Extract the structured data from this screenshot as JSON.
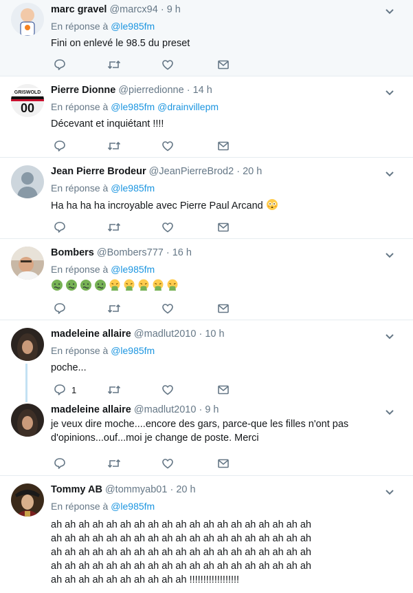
{
  "reply_prefix": "En réponse à",
  "tweets": [
    {
      "name": "marc gravel",
      "handle": "@marcx94",
      "time": "9 h",
      "reply_to": [
        "@le985fm"
      ],
      "text": "Fini on enlevé le 98.5 du preset",
      "reply_count": ""
    },
    {
      "name": "Pierre Dionne",
      "handle": "@pierredionne",
      "time": "14 h",
      "reply_to": [
        "@le985fm",
        "@drainvillepm"
      ],
      "text": "Décevant et inquiétant !!!!",
      "reply_count": ""
    },
    {
      "name": "Jean Pierre Brodeur",
      "handle": "@JeanPierreBrod2",
      "time": "20 h",
      "reply_to": [
        "@le985fm"
      ],
      "text": "Ha ha ha ha incroyable avec Pierre Paul Arcand",
      "reply_count": ""
    },
    {
      "name": "Bombers",
      "handle": "@Bombers777",
      "time": "16 h",
      "reply_to": [
        "@le985fm"
      ],
      "text": "",
      "reply_count": ""
    },
    {
      "name": "madeleine allaire",
      "handle": "@madlut2010",
      "time": "10 h",
      "reply_to": [
        "@le985fm"
      ],
      "text": "poche...",
      "reply_count": "1"
    },
    {
      "name": "madeleine allaire",
      "handle": "@madlut2010",
      "time": "9 h",
      "reply_to": [],
      "text_lines": [
        "je veux dire moche....encore des gars, parce-que les filles n'ont pas",
        "d'opinions...ouf...moi je change de poste. Merci"
      ],
      "reply_count": ""
    },
    {
      "name": "Tommy AB",
      "handle": "@tommyab01",
      "time": "20 h",
      "reply_to": [
        "@le985fm"
      ],
      "text_lines": [
        "ah ah ah ah ah ah ah ah ah ah ah ah ah ah ah ah ah ah ah",
        "ah ah ah ah ah ah ah ah ah ah ah ah ah ah ah ah ah ah ah",
        "ah ah ah ah ah ah ah ah ah ah ah ah ah ah ah ah ah ah ah",
        "ah ah ah ah ah ah ah ah ah ah ah ah ah ah ah ah ah ah ah",
        "ah ah ah ah ah ah ah ah ah ah !!!!!!!!!!!!!!!!!!"
      ],
      "reply_count": ""
    }
  ],
  "icons": {
    "reply": "reply-icon",
    "retweet": "retweet-icon",
    "like": "heart-icon",
    "dm": "envelope-icon",
    "caret": "chevron-down-icon"
  },
  "colors": {
    "link": "#1b95e0",
    "muted": "#657786",
    "text": "#14171a",
    "thread_line": "#c3e1f3",
    "highlight_bg": "#f5f8fa"
  }
}
